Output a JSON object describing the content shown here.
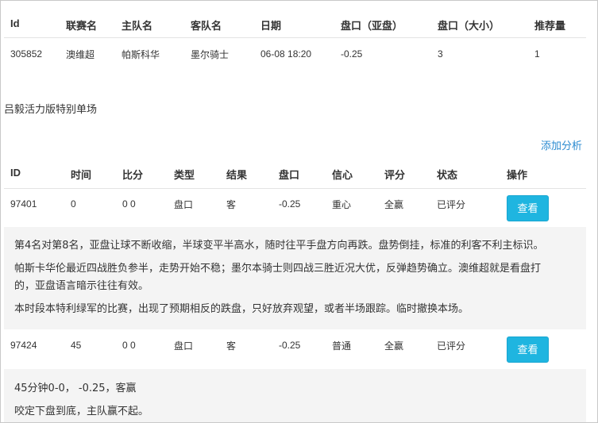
{
  "match_table": {
    "headers": [
      "Id",
      "联赛名",
      "主队名",
      "客队名",
      "日期",
      "盘口（亚盘）",
      "盘口（大小）",
      "推荐量"
    ],
    "row": [
      "305852",
      "澳维超",
      "帕斯科华",
      "墨尔骑士",
      "06-08 18:20",
      "-0.25",
      "3",
      "1"
    ]
  },
  "section_title": "吕毅活力版特别单场",
  "add_analysis_link": "添加分析",
  "analysis_table": {
    "headers": [
      "ID",
      "时间",
      "比分",
      "类型",
      "结果",
      "盘口",
      "信心",
      "评分",
      "状态",
      "操作"
    ],
    "rows": [
      {
        "cells": [
          "97401",
          "0",
          "0 0",
          "盘口",
          "客",
          "-0.25",
          "重心",
          "全赢",
          "已评分"
        ],
        "button": "查看",
        "notes": [
          "第4名对第8名，亚盘让球不断收缩，半球变平半高水，随时往平手盘方向再跌。盘势倒挂，标准的利客不利主标识。",
          "帕斯卡华伦最近四战胜负参半，走势开始不稳；墨尔本骑士则四战三胜近况大优，反弹趋势确立。澳维超就是看盘打",
          "的，亚盘语言暗示往往有效。",
          "本时段本特利绿军的比赛，出现了预期相反的跌盘，只好放弃观望，或者半场跟踪。临时撤换本场。"
        ]
      },
      {
        "cells": [
          "97424",
          "45",
          "0 0",
          "盘口",
          "客",
          "-0.25",
          "普通",
          "全赢",
          "已评分"
        ],
        "button": "查看",
        "notes": [
          "45分钟0-0， -0.25，客赢",
          "咬定下盘到底，主队赢不起。"
        ]
      }
    ]
  }
}
